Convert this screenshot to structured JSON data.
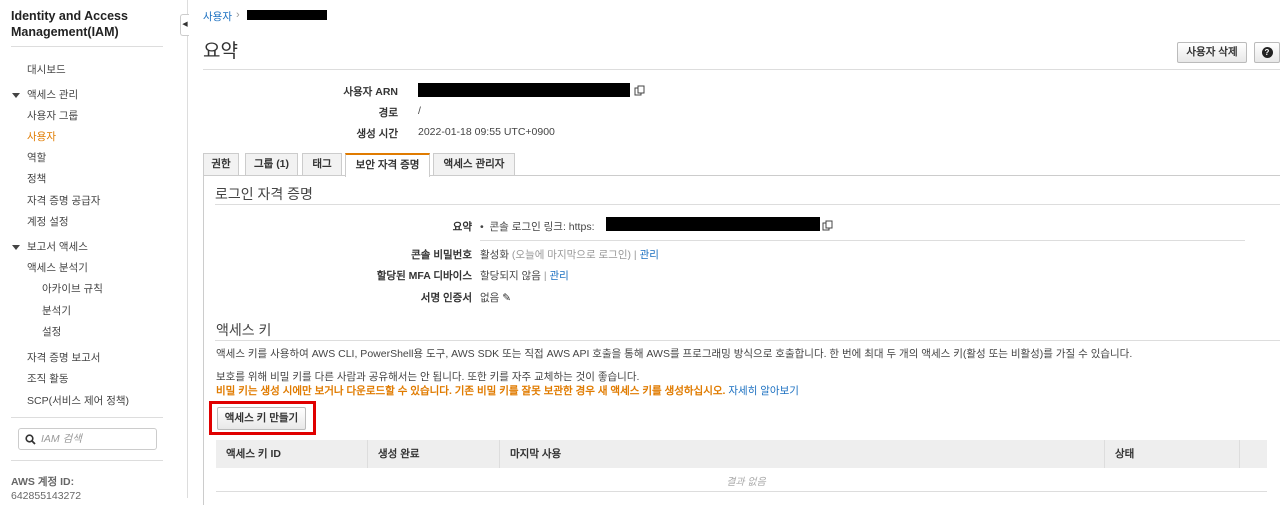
{
  "sidebar": {
    "title": "Identity and Access Management(IAM)",
    "items": [
      {
        "label": "대시보드"
      },
      {
        "label": "액세스 관리"
      },
      {
        "label": "사용자 그룹"
      },
      {
        "label": "사용자"
      },
      {
        "label": "역할"
      },
      {
        "label": "정책"
      },
      {
        "label": "자격 증명 공급자"
      },
      {
        "label": "계정 설정"
      },
      {
        "label": "보고서 액세스"
      },
      {
        "label": "액세스 분석기"
      },
      {
        "label": "아카이브 규칙"
      },
      {
        "label": "분석기"
      },
      {
        "label": "설정"
      },
      {
        "label": "자격 증명 보고서"
      },
      {
        "label": "조직 활동"
      },
      {
        "label": "SCP(서비스 제어 정책)"
      }
    ],
    "search_placeholder": "IAM 검색",
    "account_label": "AWS 계정 ID:",
    "account_id": "642855143272"
  },
  "breadcrumb": {
    "root": "사용자"
  },
  "page_title": "요약",
  "buttons": {
    "delete_user": "사용자 삭제",
    "help": "?"
  },
  "summary": {
    "arn_label": "사용자 ARN",
    "path_label": "경로",
    "path_value": "/",
    "created_label": "생성 시간",
    "created_value": "2022-01-18 09:55 UTC+0900"
  },
  "tabs": [
    {
      "label": "권한"
    },
    {
      "label": "그룹 (1)"
    },
    {
      "label": "태그"
    },
    {
      "label": "보안 자격 증명"
    },
    {
      "label": "액세스 관리자"
    }
  ],
  "login": {
    "heading": "로그인 자격 증명",
    "summary_label": "요약",
    "console_link_label": "콘솔 로그인 링크: https:",
    "password_label": "콘솔 비밀번호",
    "password_value": "활성화",
    "password_note": "(오늘에 마지막으로 로그인)",
    "manage": "관리",
    "mfa_label": "할당된 MFA 디바이스",
    "mfa_value": "할당되지 않음",
    "cert_label": "서명 인증서",
    "cert_value": "없음"
  },
  "access_keys": {
    "heading": "액세스 키",
    "desc": "액세스 키를 사용하여 AWS CLI, PowerShell용 도구, AWS SDK 또는 직접 AWS API 호출을 통해 AWS를 프로그래밍 방식으로 호출합니다. 한 번에 최대 두 개의 액세스 키(활성 또는 비활성)를 가질 수 있습니다.",
    "note": "보호를 위해 비밀 키를 다른 사람과 공유해서는 안 됩니다. 또한 키를 자주 교체하는 것이 좋습니다.",
    "warning": "비밀 키는 생성 시에만 보거나 다운로드할 수 있습니다. 기존 비밀 키를 잘못 보관한 경우 새 액세스 키를 생성하십시오.",
    "learn_more": "자세히 알아보기",
    "create_button": "액세스 키 만들기",
    "columns": [
      "액세스 키 ID",
      "생성 완료",
      "마지막 사용",
      "상태"
    ],
    "empty": "결과 없음"
  },
  "colors": {
    "accent": "#e07b00",
    "link": "#1a6fc0",
    "highlight": "#e00000"
  }
}
